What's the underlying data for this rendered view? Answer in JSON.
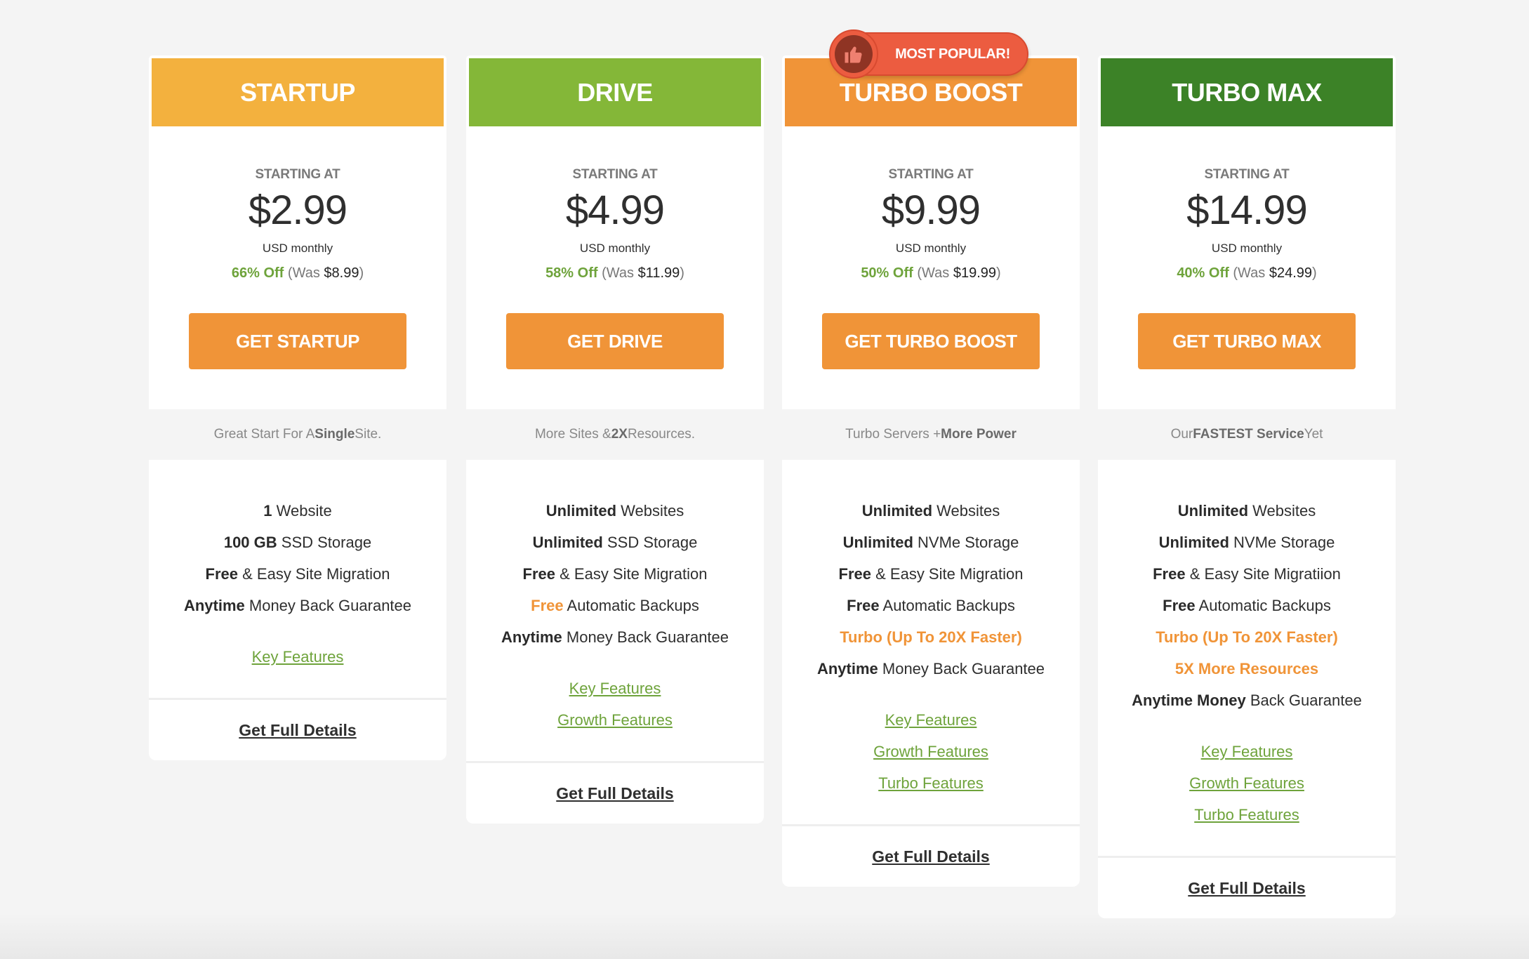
{
  "badge": {
    "label": "MOST POPULAR!",
    "icon": "thumbs-up-icon",
    "plan_index": 2
  },
  "colors": {
    "cta": "#f09438",
    "discount_green": "#6ea33b",
    "link_green": "#6ea33b",
    "highlight_orange": "#f09438",
    "badge_red": "#ec5c40"
  },
  "plans": [
    {
      "name": "STARTUP",
      "header_color": "#f3b13e",
      "starting_label": "STARTING AT",
      "price": "$2.99",
      "period": "USD monthly",
      "discount": "66% Off",
      "was_prefix": "(Was ",
      "was_price": "$8.99",
      "was_suffix": ")",
      "cta": "GET STARTUP",
      "tagline": [
        {
          "text": "Great Start For A ",
          "bold": false
        },
        {
          "text": "Single",
          "bold": true
        },
        {
          "text": " Site.",
          "bold": false
        }
      ],
      "features": [
        [
          {
            "text": "1",
            "style": "bold"
          },
          {
            "text": " Website",
            "style": "normal"
          }
        ],
        [
          {
            "text": "100 GB",
            "style": "bold"
          },
          {
            "text": " SSD Storage",
            "style": "normal"
          }
        ],
        [
          {
            "text": "Free",
            "style": "bold"
          },
          {
            "text": " & Easy Site Migration",
            "style": "normal"
          }
        ],
        [
          {
            "text": "Anytime",
            "style": "bold"
          },
          {
            "text": " Money Back Guarantee",
            "style": "normal"
          }
        ]
      ],
      "links": [
        "Key Features"
      ],
      "details": "Get Full Details"
    },
    {
      "name": "DRIVE",
      "header_color": "#84b738",
      "starting_label": "STARTING AT",
      "price": "$4.99",
      "period": "USD monthly",
      "discount": "58% Off",
      "was_prefix": "(Was ",
      "was_price": "$11.99",
      "was_suffix": ")",
      "cta": "GET DRIVE",
      "tagline": [
        {
          "text": "More Sites & ",
          "bold": false
        },
        {
          "text": "2X",
          "bold": true
        },
        {
          "text": " Resources.",
          "bold": false
        }
      ],
      "features": [
        [
          {
            "text": "Unlimited",
            "style": "bold"
          },
          {
            "text": " Websites",
            "style": "normal"
          }
        ],
        [
          {
            "text": "Unlimited",
            "style": "bold"
          },
          {
            "text": " SSD Storage",
            "style": "normal"
          }
        ],
        [
          {
            "text": "Free",
            "style": "bold"
          },
          {
            "text": " & Easy Site Migration",
            "style": "normal"
          }
        ],
        [
          {
            "text": "Free",
            "style": "orange"
          },
          {
            "text": " Automatic Backups",
            "style": "normal"
          }
        ],
        [
          {
            "text": "Anytime",
            "style": "bold"
          },
          {
            "text": " Money Back Guarantee",
            "style": "normal"
          }
        ]
      ],
      "links": [
        "Key Features",
        "Growth Features"
      ],
      "details": "Get Full Details"
    },
    {
      "name": "TURBO BOOST",
      "header_color": "#f09438",
      "starting_label": "STARTING AT",
      "price": "$9.99",
      "period": "USD monthly",
      "discount": "50% Off",
      "was_prefix": "(Was ",
      "was_price": "$19.99",
      "was_suffix": ")",
      "cta": "GET TURBO BOOST",
      "tagline": [
        {
          "text": "Turbo Servers + ",
          "bold": false
        },
        {
          "text": "More Power",
          "bold": true
        }
      ],
      "features": [
        [
          {
            "text": "Unlimited",
            "style": "bold"
          },
          {
            "text": " Websites",
            "style": "normal"
          }
        ],
        [
          {
            "text": "Unlimited",
            "style": "bold"
          },
          {
            "text": " NVMe Storage",
            "style": "normal"
          }
        ],
        [
          {
            "text": "Free",
            "style": "bold"
          },
          {
            "text": " & Easy Site Migration",
            "style": "normal"
          }
        ],
        [
          {
            "text": "Free",
            "style": "bold"
          },
          {
            "text": " Automatic Backups",
            "style": "normal"
          }
        ],
        [
          {
            "text": "Turbo (Up To 20X Faster)",
            "style": "orange"
          }
        ],
        [
          {
            "text": "Anytime",
            "style": "bold"
          },
          {
            "text": " Money Back Guarantee",
            "style": "normal"
          }
        ]
      ],
      "links": [
        "Key Features",
        "Growth Features",
        "Turbo Features"
      ],
      "details": "Get Full Details"
    },
    {
      "name": "TURBO MAX",
      "header_color": "#3c8227",
      "starting_label": "STARTING AT",
      "price": "$14.99",
      "period": "USD monthly",
      "discount": "40% Off",
      "was_prefix": "(Was ",
      "was_price": "$24.99",
      "was_suffix": ")",
      "cta": "GET TURBO MAX",
      "tagline": [
        {
          "text": "Our ",
          "bold": false
        },
        {
          "text": "FASTEST Service",
          "bold": true
        },
        {
          "text": " Yet",
          "bold": false
        }
      ],
      "features": [
        [
          {
            "text": "Unlimited",
            "style": "bold"
          },
          {
            "text": " Websites",
            "style": "normal"
          }
        ],
        [
          {
            "text": "Unlimited",
            "style": "bold"
          },
          {
            "text": " NVMe Storage",
            "style": "normal"
          }
        ],
        [
          {
            "text": "Free",
            "style": "bold"
          },
          {
            "text": " & Easy Site Migratiion",
            "style": "normal"
          }
        ],
        [
          {
            "text": "Free",
            "style": "bold"
          },
          {
            "text": " Automatic Backups",
            "style": "normal"
          }
        ],
        [
          {
            "text": "Turbo (Up To 20X Faster)",
            "style": "orange"
          }
        ],
        [
          {
            "text": "5X More Resources",
            "style": "orange"
          }
        ],
        [
          {
            "text": "Anytime Money",
            "style": "bold"
          },
          {
            "text": " Back Guarantee",
            "style": "normal"
          }
        ]
      ],
      "links": [
        "Key Features",
        "Growth Features",
        "Turbo Features"
      ],
      "details": "Get Full Details"
    }
  ]
}
